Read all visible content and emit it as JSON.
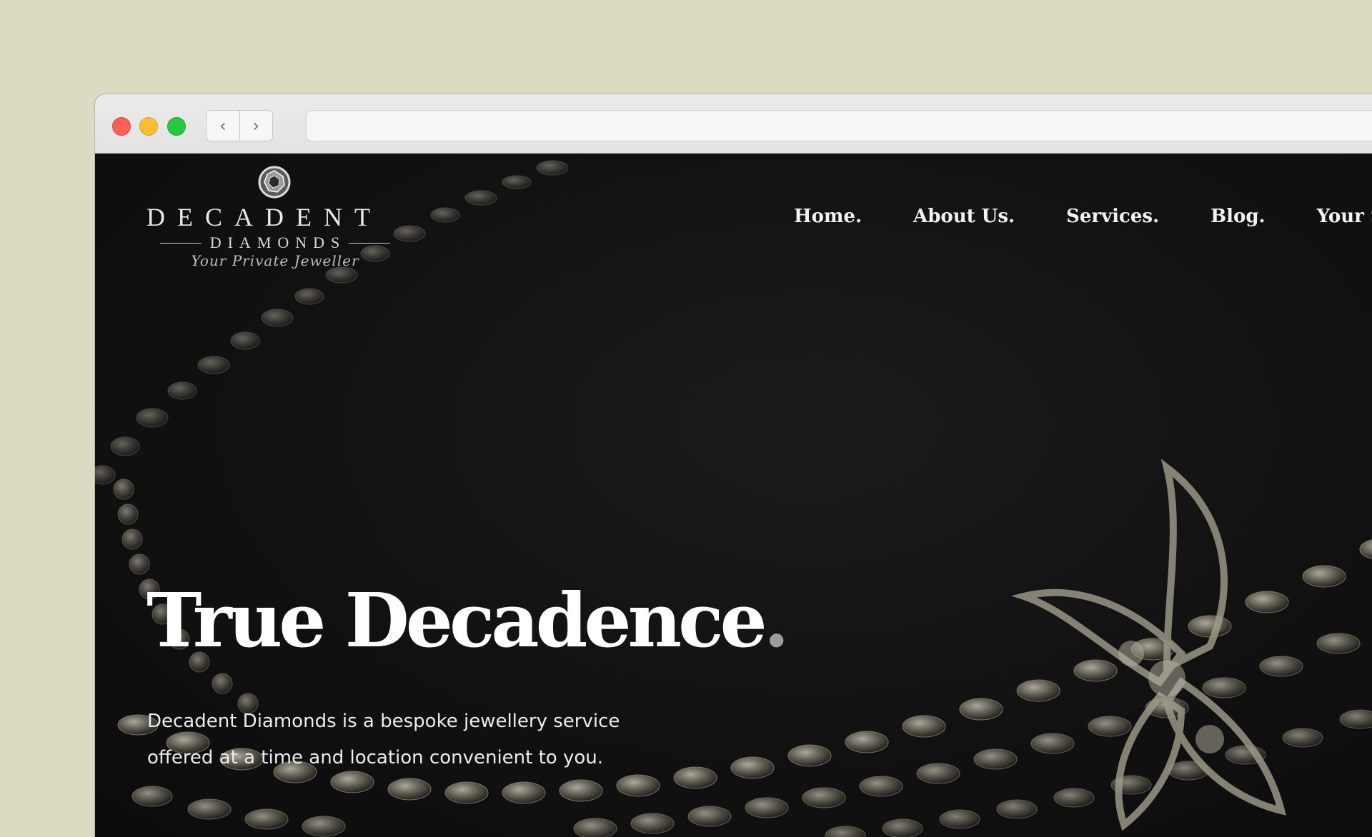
{
  "browser": {
    "back_icon": "chevron-left-icon",
    "forward_icon": "chevron-right-icon",
    "back_glyph": "‹",
    "forward_glyph": "›",
    "address_value": ""
  },
  "logo": {
    "brand": "DECADENT",
    "sub": "DIAMONDS",
    "tagline": "Your Private Jeweller",
    "icon": "diamond-gem-icon"
  },
  "nav": {
    "items": [
      {
        "label": "Home."
      },
      {
        "label": "About Us."
      },
      {
        "label": "Services."
      },
      {
        "label": "Blog."
      },
      {
        "label": "Your Stories."
      }
    ]
  },
  "hero": {
    "title": "True Decadence",
    "title_accent": ".",
    "text": "Decadent Diamonds is a bespoke jewellery service offered at a time and location convenient to you."
  },
  "colors": {
    "page_bg": "#dcdac1",
    "hero_bg": "#111112",
    "accent_dot": "#9c9c9c",
    "traffic_red": "#fe5f57",
    "traffic_yellow": "#febc2e",
    "traffic_green": "#28c840"
  }
}
